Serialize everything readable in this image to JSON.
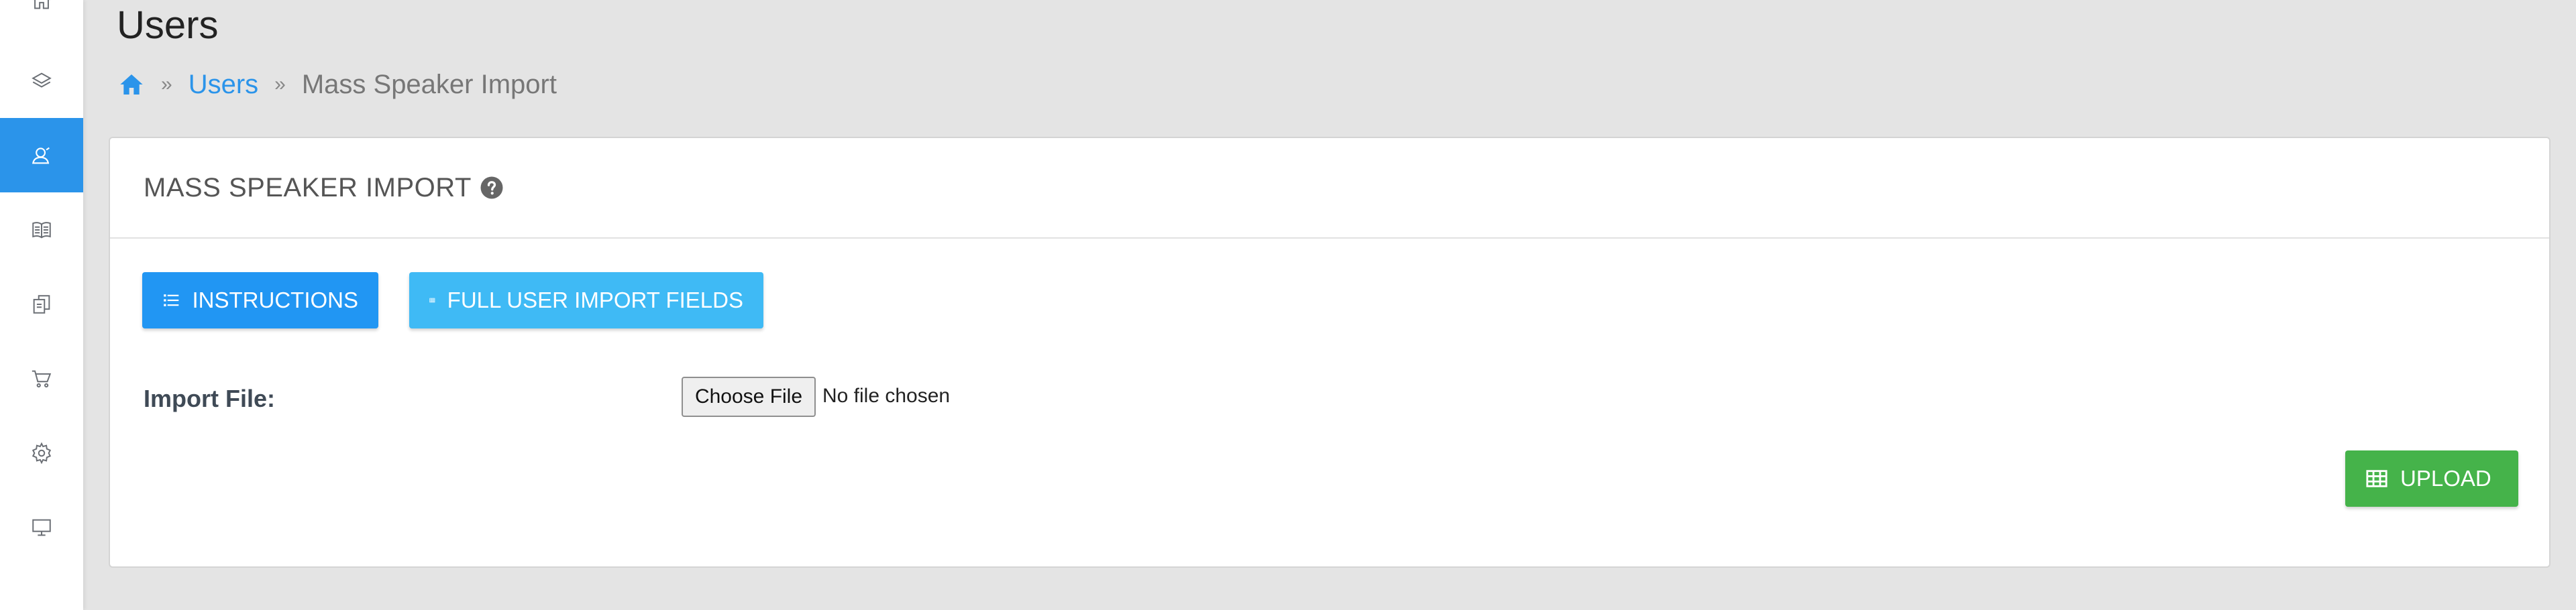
{
  "sidebar": {
    "items": [
      {
        "icon": "home-icon",
        "active": false
      },
      {
        "icon": "layers-icon",
        "active": false
      },
      {
        "icon": "user-icon",
        "active": true
      },
      {
        "icon": "book-icon",
        "active": false
      },
      {
        "icon": "documents-icon",
        "active": false
      },
      {
        "icon": "cart-icon",
        "active": false
      },
      {
        "icon": "gear-icon",
        "active": false
      },
      {
        "icon": "monitor-icon",
        "active": false
      }
    ],
    "active_color": "#2b94ea",
    "icon_color": "#6b6f75"
  },
  "header": {
    "title": "Users",
    "breadcrumb": {
      "home_icon": "home-icon",
      "separator": "»",
      "items": [
        "Users",
        "Mass Speaker Import"
      ]
    }
  },
  "card": {
    "title": "MASS SPEAKER IMPORT",
    "help_icon": "question-circle-icon",
    "buttons": {
      "instructions": {
        "label": "INSTRUCTIONS",
        "icon": "list-icon",
        "color": "#2196f3"
      },
      "full_fields": {
        "label": "FULL USER IMPORT FIELDS",
        "icon": "table-icon",
        "color": "#3fbaf5"
      },
      "upload": {
        "label": "UPLOAD",
        "icon": "table-icon",
        "color": "#45b34a"
      }
    },
    "import_file": {
      "label": "Import File:",
      "choose_label": "Choose File",
      "status": "No file chosen"
    }
  }
}
